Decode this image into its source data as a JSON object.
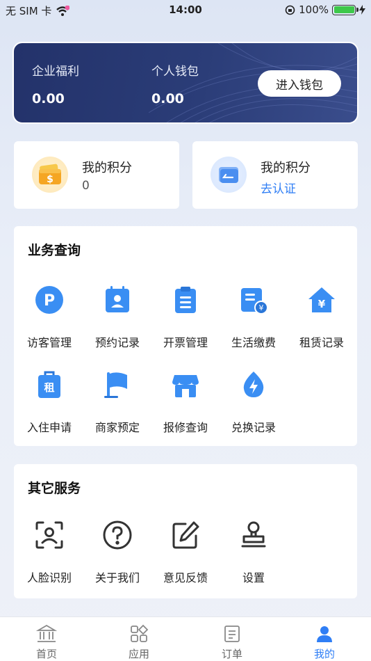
{
  "status_bar": {
    "carrier": "无 SIM 卡",
    "time": "14:00",
    "battery": "100%"
  },
  "wallet": {
    "enterprise_label": "企业福利",
    "enterprise_value": "0.00",
    "personal_label": "个人钱包",
    "personal_value": "0.00",
    "enter_button": "进入钱包"
  },
  "points_cards": [
    {
      "title": "我的积分",
      "sub": "0"
    },
    {
      "title": "我的积分",
      "sub": "去认证"
    }
  ],
  "business": {
    "title": "业务查询",
    "items": [
      {
        "label": "访客管理",
        "icon": "parking-icon"
      },
      {
        "label": "预约记录",
        "icon": "calendar-person-icon"
      },
      {
        "label": "开票管理",
        "icon": "clipboard-icon"
      },
      {
        "label": "生活缴费",
        "icon": "bill-yen-icon"
      },
      {
        "label": "租赁记录",
        "icon": "house-yen-icon"
      },
      {
        "label": "入住申请",
        "icon": "rent-bag-icon"
      },
      {
        "label": "商家预定",
        "icon": "flag-icon"
      },
      {
        "label": "报修查询",
        "icon": "store-icon"
      },
      {
        "label": "兑换记录",
        "icon": "lightning-icon"
      }
    ]
  },
  "other": {
    "title": "其它服务",
    "items": [
      {
        "label": "人脸识别",
        "icon": "face-scan-icon"
      },
      {
        "label": "关于我们",
        "icon": "question-icon"
      },
      {
        "label": "意见反馈",
        "icon": "edit-icon"
      },
      {
        "label": "设置",
        "icon": "stamp-icon"
      }
    ]
  },
  "tabbar": [
    {
      "label": "首页",
      "icon": "bank-icon"
    },
    {
      "label": "应用",
      "icon": "apps-icon"
    },
    {
      "label": "订单",
      "icon": "order-icon"
    },
    {
      "label": "我的",
      "icon": "user-icon",
      "active": true
    }
  ],
  "colors": {
    "accent": "#2f7ef5",
    "wallet_bg": "#23326a",
    "link": "#2f7ef5"
  }
}
